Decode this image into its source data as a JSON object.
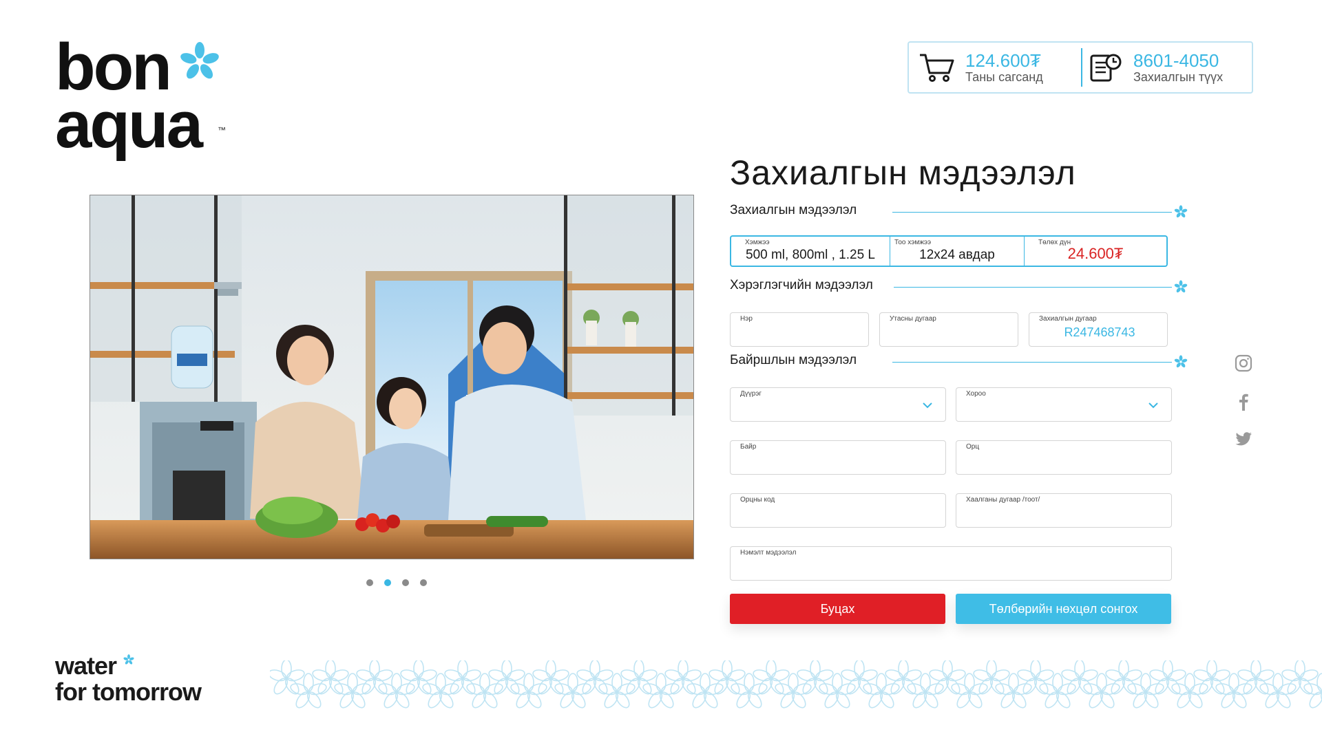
{
  "brand": {
    "logo_line1": "bon",
    "logo_line2": "aqua",
    "trademark": "™",
    "tagline_line1": "water",
    "tagline_line2": "for tomorrow",
    "accent_color": "#3ab7e3",
    "danger_color": "#e01f26"
  },
  "header": {
    "cart": {
      "icon": "cart-icon",
      "amount": "124.600₮",
      "label": "Таны сагсанд"
    },
    "orders": {
      "icon": "order-history-icon",
      "phone": "8601-4050",
      "label": "Захиалгын түүх"
    }
  },
  "carousel": {
    "slides": 4,
    "active_index": 1
  },
  "form": {
    "title": "Захиалгын мэдээлэл",
    "order_section": {
      "title": "Захиалгын мэдээлэл",
      "size_label": "Хэмжээ",
      "size_value": "500 ml, 800ml , 1.25 L",
      "qty_label": "Тоо хэмжээ",
      "qty_value": "12x24 авдар",
      "total_label": "Төлөх дүн",
      "total_value": "24.600₮"
    },
    "user_section": {
      "title": "Хэрэглэгчийн мэдээлэл",
      "name_label": "Нэр",
      "phone_label": "Утасны дугаар",
      "order_no_label": "Захиалгын дугаар",
      "order_no_value": "R247468743"
    },
    "location_section": {
      "title": "Байршлын мэдээлэл",
      "district_label": "Дүүрэг",
      "khoroo_label": "Хороо",
      "building_label": "Байр",
      "entrance_label": "Орц",
      "entrance_code_label": "Орцны код",
      "door_label": "Хаалганы дугаар /тоот/",
      "extra_label": "Нэмэлт мэдээлэл"
    },
    "buttons": {
      "back": "Буцах",
      "pay": "Төлбөрийн нөхцөл сонгох"
    }
  },
  "social": [
    "instagram-icon",
    "facebook-icon",
    "twitter-icon"
  ]
}
